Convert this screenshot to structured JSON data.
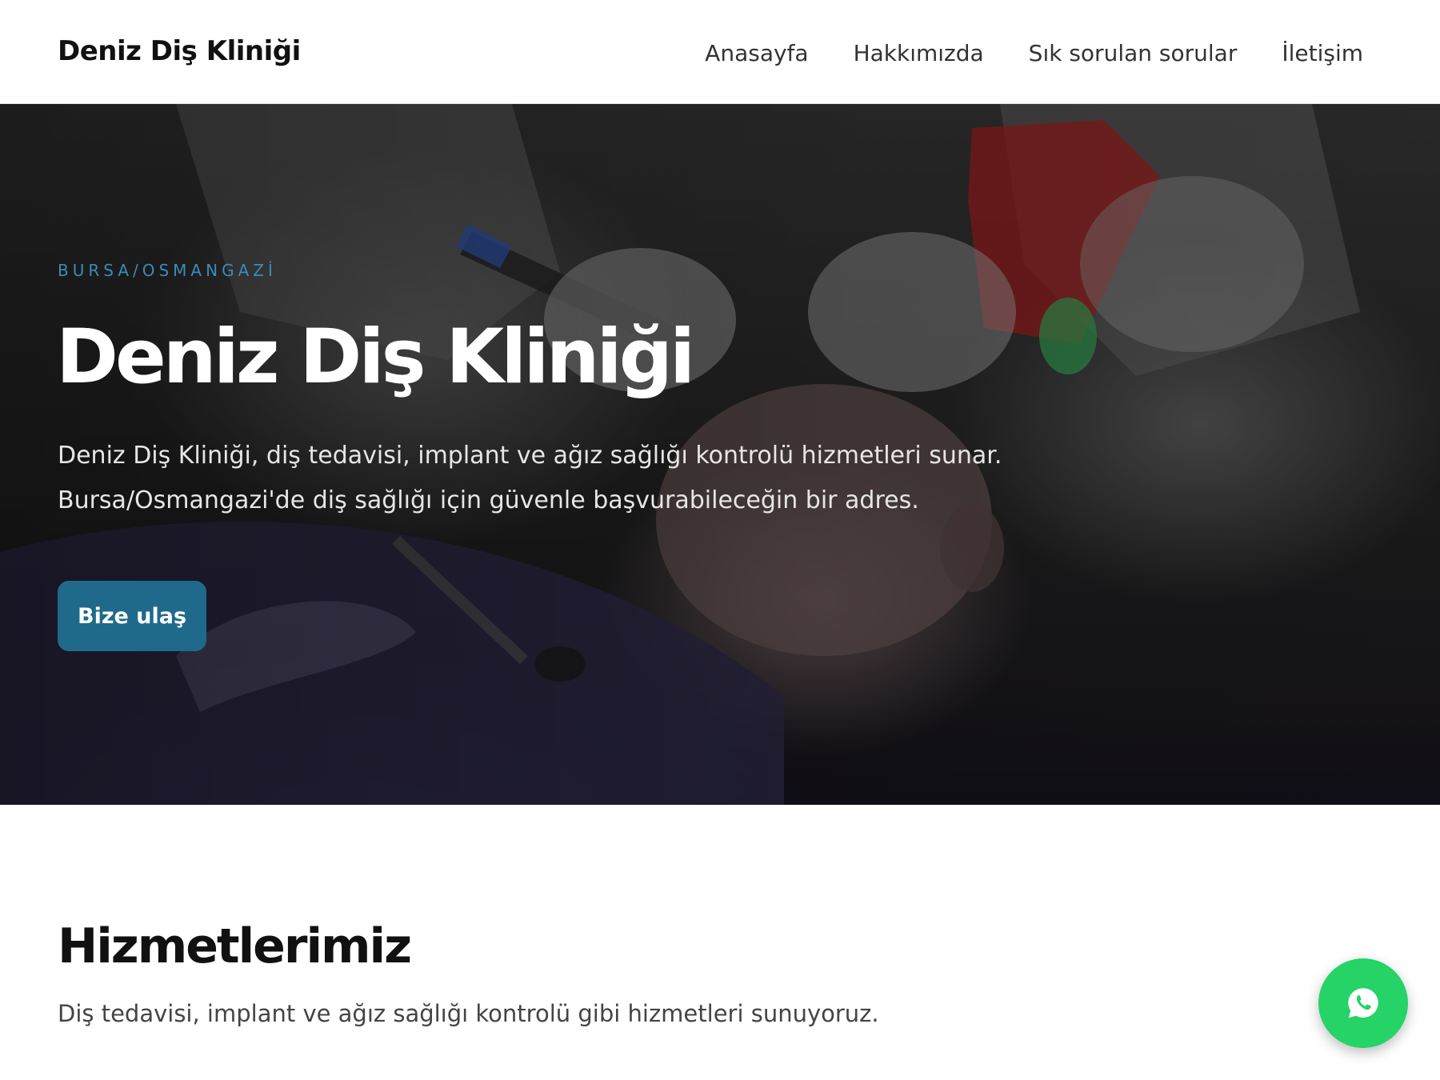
{
  "header": {
    "brand": "Deniz Diş Kliniği",
    "nav": [
      {
        "label": "Anasayfa"
      },
      {
        "label": "Hakkımızda"
      },
      {
        "label": "Sık sorulan sorular"
      },
      {
        "label": "İletişim"
      }
    ]
  },
  "hero": {
    "eyebrow": "BURSA/OSMANGAZİ",
    "title": "Deniz Diş Kliniği",
    "description": "Deniz Diş Kliniği, diş tedavisi, implant ve ağız sağlığı kontrolü hizmetleri sunar. Bursa/Osmangazi'de diş sağlığı için güvenle başvurabileceğin bir adres.",
    "cta_label": "Bize ulaş"
  },
  "services": {
    "title": "Hizmetlerimiz",
    "description": "Diş tedavisi, implant ve ağız sağlığı kontrolü gibi hizmetleri sunuyoruz."
  },
  "floating": {
    "icon": "whatsapp-icon"
  },
  "colors": {
    "accent": "#1f6a8a",
    "eyebrow": "#3b8bb8",
    "whatsapp": "#25d366"
  }
}
